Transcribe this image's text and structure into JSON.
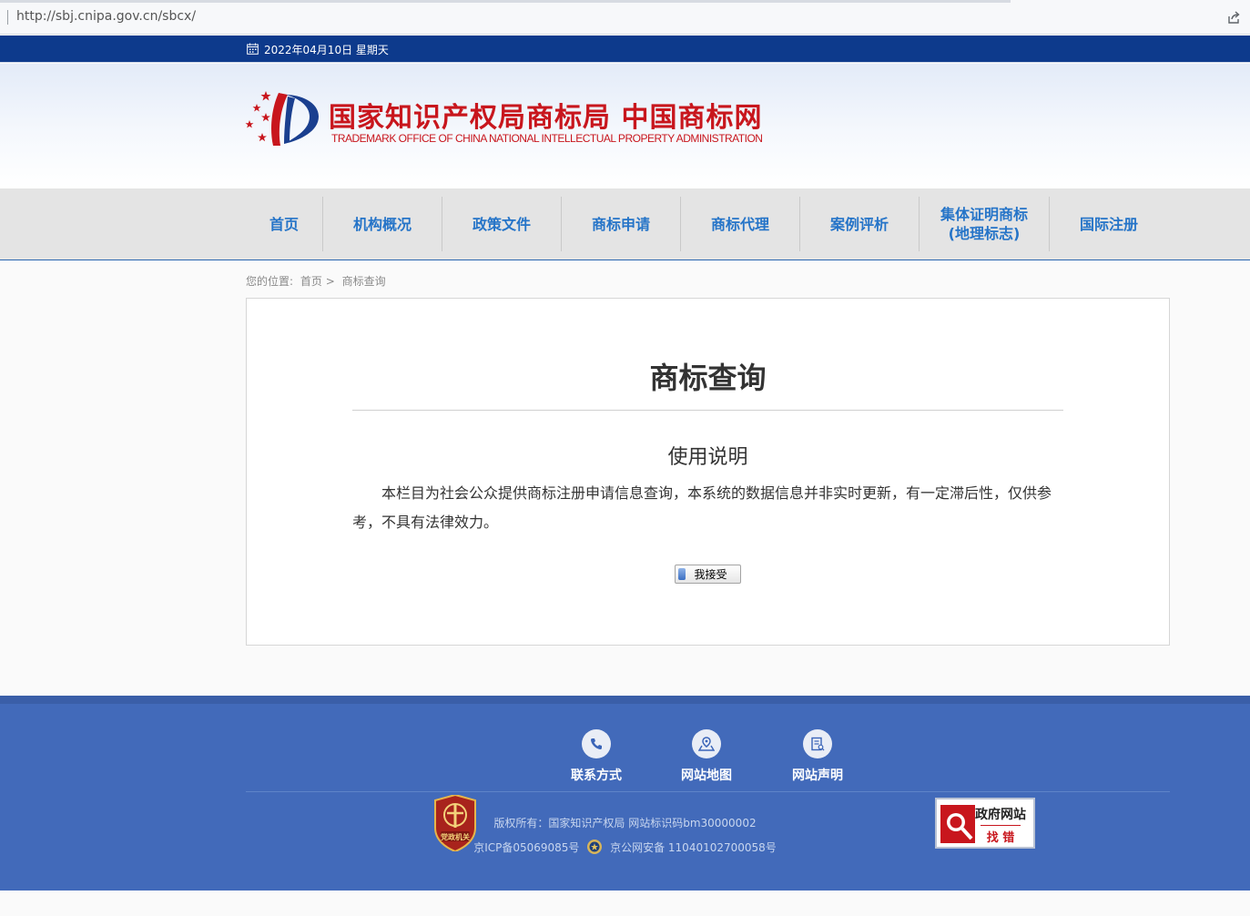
{
  "browser": {
    "url": "http://sbj.cnipa.gov.cn/sbcx/"
  },
  "topbar": {
    "date": "2022年04月10日 星期天",
    "calendar_icon": "calendar-icon"
  },
  "header": {
    "title_cn": "国家知识产权局商标局  中国商标网",
    "title_en": "TRADEMARK OFFICE OF CHINA NATIONAL INTELLECTUAL PROPERTY ADMINISTRATION",
    "brand_color": "#c8161d"
  },
  "nav": {
    "items": [
      {
        "label": "首页"
      },
      {
        "label": "机构概况"
      },
      {
        "label": "政策文件"
      },
      {
        "label": "商标申请"
      },
      {
        "label": "商标代理"
      },
      {
        "label": "案例评析"
      },
      {
        "label": "集体证明商标\n(地理标志)"
      },
      {
        "label": "国际注册"
      }
    ],
    "accent": "#2574c8"
  },
  "breadcrumb": {
    "prefix": "您的位置:",
    "home": "首页 >",
    "current": "商标查询"
  },
  "main": {
    "title": "商标查询",
    "subtitle": "使用说明",
    "body": "本栏目为社会公众提供商标注册申请信息查询，本系统的数据信息并非实时更新，有一定滞后性，仅供参考，不具有法律效力。",
    "accept_button": "我接受"
  },
  "footer": {
    "links": [
      {
        "label": "联系方式",
        "icon": "phone-icon"
      },
      {
        "label": "网站地图",
        "icon": "map-pin-icon"
      },
      {
        "label": "网站声明",
        "icon": "document-icon"
      }
    ],
    "copyright": "版权所有：国家知识产权局 网站标识码bm30000002",
    "icp": "京ICP备05069085号",
    "police": "京公网安备 11040102700058号",
    "party_badge": "党政机关",
    "gov_badge_line1": "政府网站",
    "gov_badge_line2": "找 错",
    "bg_color": "#426aba"
  }
}
